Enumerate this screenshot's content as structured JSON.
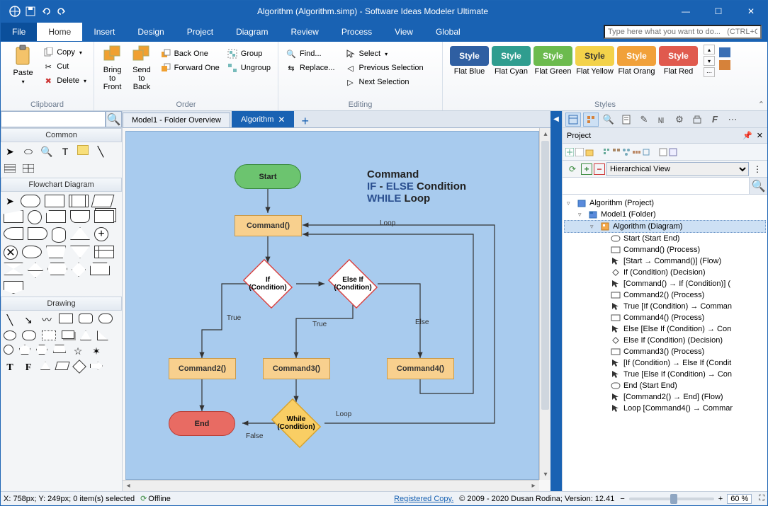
{
  "app": {
    "title": "Algorithm (Algorithm.simp) - Software Ideas Modeler Ultimate"
  },
  "menu": {
    "file": "File",
    "tabs": [
      "Home",
      "Insert",
      "Design",
      "Project",
      "Diagram",
      "Review",
      "Process",
      "View",
      "Global"
    ],
    "active": "Home",
    "search_placeholder": "Type here what you want to do...   (CTRL+Q)"
  },
  "ribbon": {
    "clipboard": {
      "paste": "Paste",
      "copy": "Copy",
      "cut": "Cut",
      "delete": "Delete",
      "label": "Clipboard"
    },
    "order": {
      "bring_front": "Bring to\nFront",
      "send_back": "Send to\nBack",
      "back_one": "Back One",
      "forward_one": "Forward One",
      "group": "Group",
      "ungroup": "Ungroup",
      "label": "Order"
    },
    "editing": {
      "find": "Find...",
      "replace": "Replace...",
      "select": "Select",
      "prev_sel": "Previous Selection",
      "next_sel": "Next Selection",
      "label": "Editing"
    },
    "styles": {
      "items": [
        {
          "label": "Style",
          "bg": "#2f5fa2",
          "fg": "#fff",
          "name": "Flat Blue"
        },
        {
          "label": "Style",
          "bg": "#2f9d8f",
          "fg": "#fff",
          "name": "Flat Cyan"
        },
        {
          "label": "Style",
          "bg": "#6cbb4e",
          "fg": "#fff",
          "name": "Flat Green"
        },
        {
          "label": "Style",
          "bg": "#f3d24a",
          "fg": "#333",
          "name": "Flat Yellow"
        },
        {
          "label": "Style",
          "bg": "#f1a13a",
          "fg": "#fff",
          "name": "Flat Orang"
        },
        {
          "label": "Style",
          "bg": "#e05a4e",
          "fg": "#fff",
          "name": "Flat Red"
        }
      ],
      "label": "Styles"
    }
  },
  "toolbox": {
    "sections": {
      "common": "Common",
      "flowchart": "Flowchart Diagram",
      "drawing": "Drawing"
    }
  },
  "tabs": {
    "items": [
      {
        "label": "Model1 - Folder Overview",
        "active": false
      },
      {
        "label": "Algorithm",
        "active": true
      }
    ]
  },
  "diagram": {
    "title_l1": "Command",
    "title_l2a": "IF",
    "title_l2b": " - ",
    "title_l2c": "ELSE",
    "title_l2d": " Condition",
    "title_l3a": "WHILE",
    "title_l3b": " Loop",
    "nodes": {
      "start": "Start",
      "cmd0": "Command()",
      "if": "If\n(Condition)",
      "elseif": "Else If\n(Condition)",
      "cmd2": "Command2()",
      "cmd3": "Command3()",
      "cmd4": "Command4()",
      "while": "While\n(Condition)",
      "end": "End"
    },
    "labels": {
      "true1": "True",
      "true2": "True",
      "else": "Else",
      "false": "False",
      "loop1": "Loop",
      "loop2": "Loop"
    }
  },
  "project": {
    "title": "Project",
    "view": "Hierarchical View",
    "tree": [
      {
        "indent": 0,
        "exp": "▿",
        "icon": "proj",
        "label": "Algorithm (Project)"
      },
      {
        "indent": 1,
        "exp": "▿",
        "icon": "fold",
        "label": "Model1 (Folder)"
      },
      {
        "indent": 2,
        "exp": "▿",
        "icon": "diag",
        "label": "Algorithm (Diagram)",
        "sel": true
      },
      {
        "indent": 3,
        "exp": "",
        "icon": "term",
        "label": "Start (Start End)"
      },
      {
        "indent": 3,
        "exp": "",
        "icon": "proc",
        "label": "Command() (Process)"
      },
      {
        "indent": 3,
        "exp": "",
        "icon": "flow",
        "label": "[Start → Command()] (Flow)"
      },
      {
        "indent": 3,
        "exp": "",
        "icon": "dec",
        "label": "If (Condition) (Decision)"
      },
      {
        "indent": 3,
        "exp": "",
        "icon": "flow",
        "label": "[Command() → If (Condition)] ("
      },
      {
        "indent": 3,
        "exp": "",
        "icon": "proc",
        "label": "Command2() (Process)"
      },
      {
        "indent": 3,
        "exp": "",
        "icon": "flow",
        "label": "True [If (Condition) → Comman"
      },
      {
        "indent": 3,
        "exp": "",
        "icon": "proc",
        "label": "Command4() (Process)"
      },
      {
        "indent": 3,
        "exp": "",
        "icon": "flow",
        "label": "Else [Else If (Condition) → Con"
      },
      {
        "indent": 3,
        "exp": "",
        "icon": "dec",
        "label": "Else If (Condition) (Decision)"
      },
      {
        "indent": 3,
        "exp": "",
        "icon": "proc",
        "label": "Command3() (Process)"
      },
      {
        "indent": 3,
        "exp": "",
        "icon": "flow",
        "label": "[If (Condition) → Else If (Condit"
      },
      {
        "indent": 3,
        "exp": "",
        "icon": "flow",
        "label": "True [Else If (Condition) → Con"
      },
      {
        "indent": 3,
        "exp": "",
        "icon": "term",
        "label": "End (Start End)"
      },
      {
        "indent": 3,
        "exp": "",
        "icon": "flow",
        "label": "[Command2() → End] (Flow)"
      },
      {
        "indent": 3,
        "exp": "",
        "icon": "flow",
        "label": "Loop [Command4() → Commar"
      }
    ]
  },
  "status": {
    "coords": "X: 758px; Y: 249px; 0 item(s) selected",
    "offline": "Offline",
    "registered": "Registered Copy.",
    "copyright": "© 2009 - 2020 Dusan Rodina; Version: 12.41",
    "zoom": "60 %"
  }
}
